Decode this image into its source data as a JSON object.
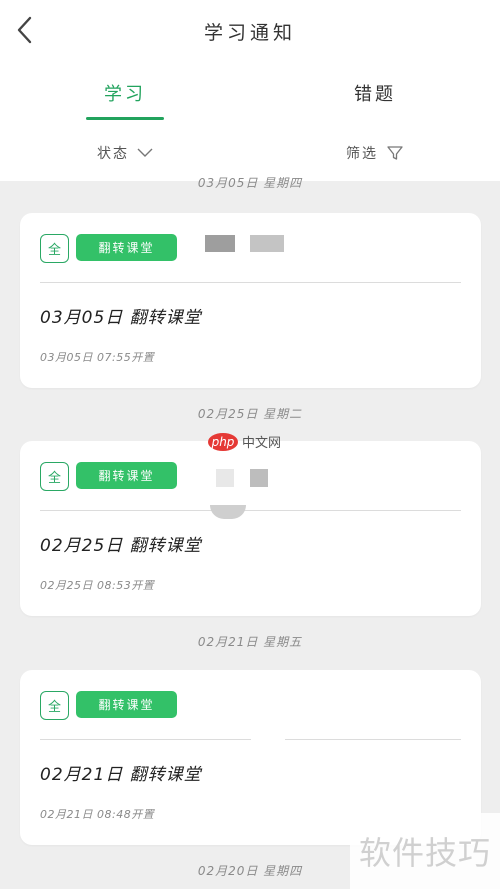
{
  "header": {
    "title": "学习通知",
    "back_icon": "chevron-left-icon"
  },
  "tabs": [
    {
      "label": "学习",
      "active": true
    },
    {
      "label": "错题",
      "active": false
    }
  ],
  "filters": {
    "status_label": "状态",
    "filter_label": "筛选"
  },
  "top_partial_date": "03月05日 星期四",
  "notices": [
    {
      "date_header": "",
      "badge_all": "全",
      "badge_type": "翻转课堂",
      "title": "03月05日 翻转课堂",
      "time": "03月05日 07:55开置"
    },
    {
      "date_header": "02月25日 星期二",
      "badge_all": "全",
      "badge_type": "翻转课堂",
      "title": "02月25日 翻转课堂",
      "time": "02月25日 08:53开置"
    },
    {
      "date_header": "02月21日 星期五",
      "badge_all": "全",
      "badge_type": "翻转课堂",
      "title": "02月21日 翻转课堂",
      "time": "02月21日 08:48开置"
    }
  ],
  "bottom_partial_date": "02月20日 星期四",
  "watermark": {
    "text": "软件技巧",
    "logo_mark": "php",
    "logo_text": "中文网"
  },
  "colors": {
    "accent": "#22a35d",
    "badge_green": "#33c168",
    "background": "#eeeeee",
    "card": "#ffffff"
  }
}
